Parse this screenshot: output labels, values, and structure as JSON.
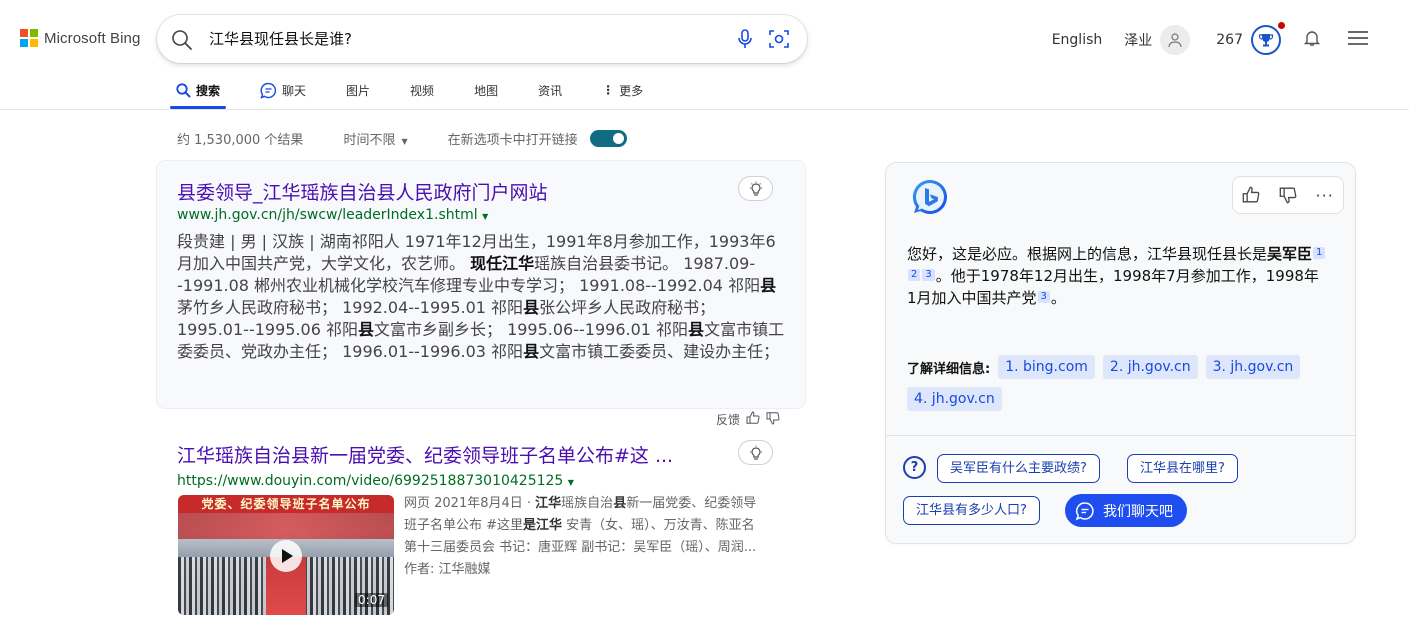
{
  "header": {
    "brand": "Microsoft Bing",
    "brand_colors": [
      "#f25022",
      "#7fba00",
      "#00a4ef",
      "#ffb900"
    ],
    "query": "江华县现任县长是谁?",
    "language": "English",
    "user_name": "泽业",
    "points": "267"
  },
  "tabs": [
    {
      "label": "搜索",
      "icon": "search-icon",
      "active": true
    },
    {
      "label": "聊天",
      "icon": "chat-icon",
      "active": false
    },
    {
      "label": "图片",
      "icon": "",
      "active": false
    },
    {
      "label": "视频",
      "icon": "",
      "active": false
    },
    {
      "label": "地图",
      "icon": "",
      "active": false
    },
    {
      "label": "资讯",
      "icon": "",
      "active": false
    },
    {
      "label": "更多",
      "icon": "more-vertical-icon",
      "active": false
    }
  ],
  "filters": {
    "result_count": "约 1,530,000 个结果",
    "time_filter": "时间不限",
    "new_tab_label": "在新选项卡中打开链接",
    "new_tab_enabled": true
  },
  "results": [
    {
      "title": "县委领导_江华瑶族自治县人民政府门户网站",
      "url": "www.jh.gov.cn/jh/swcw/leaderIndex1.shtml",
      "snippet_html": "段贵建 | 男 | 汉族 | 湖南祁阳人 1971年12月出生，1991年8月参加工作，1993年6月加入中国共产党，大学文化，农艺师。 <b>现任江华</b>瑶族自治县委书记。 1987.09--1991.08 郴州农业机械化学校汽车修理专业中专学习； 1991.08--1992.04 祁阳<b>县</b>茅竹乡人民政府秘书； 1992.04--1995.01 祁阳<b>县</b>张公坪乡人民政府秘书； 1995.01--1995.06 祁阳<b>县</b>文富市乡副乡长； 1995.06--1996.01 祁阳<b>县</b>文富市镇工委委员、党政办主任； 1996.01--1996.03 祁阳<b>县</b>文富市镇工委委员、建设办主任；",
      "feedback_label": "反馈"
    },
    {
      "title": "江华瑶族自治县新一届党委、纪委领导班子名单公布#这 ...",
      "url": "https://www.douyin.com/video/6992518873010425125",
      "thumb_banner": "党委、纪委领导班子名单公布",
      "duration": "0:07",
      "meta_line1_html": "网页  2021年8月4日 · <b>江华</b>瑶族自治<b>县</b>新一届党委、纪委领导",
      "meta_line2_html": "班子名单公布 #这里<b>是江华</b> 安青（女、瑶）、万汝青、陈亚名",
      "meta_line3": "第十三届委员会 书记：唐亚辉 副书记：吴军臣（瑶）、周润...",
      "author": "作者: 江华融媒"
    }
  ],
  "copilot": {
    "answer_part1": "您好，这是必应。根据网上的信息，江华县现任县长是",
    "answer_name": "吴军臣",
    "answer_part2": "。他于1978年12月出生，1998年7月参加工作，1998年1月加入中国共产党",
    "answer_end": "。",
    "citations_a": [
      "1",
      "2",
      "3"
    ],
    "citations_b": [
      "3"
    ],
    "learn_more_label": "了解详细信息:",
    "sources": [
      "1. bing.com",
      "2. jh.gov.cn",
      "3. jh.gov.cn",
      "4. jh.gov.cn"
    ],
    "suggestions": [
      "吴军臣有什么主要政绩?",
      "江华县在哪里?",
      "江华县有多少人口?"
    ],
    "chat_button": "我们聊天吧"
  }
}
